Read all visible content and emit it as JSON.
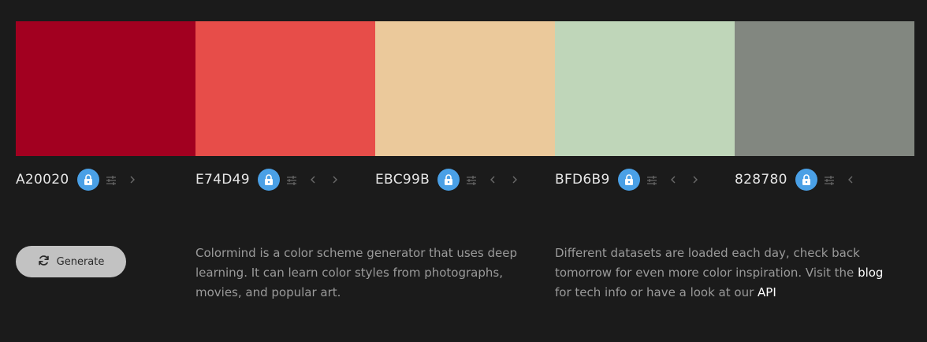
{
  "palette": {
    "colors": [
      {
        "hex": "A20020",
        "swatch": "#A20020",
        "locked": true,
        "arrows": [
          "next"
        ]
      },
      {
        "hex": "E74D49",
        "swatch": "#E74D49",
        "locked": true,
        "arrows": [
          "prev",
          "next"
        ]
      },
      {
        "hex": "EBC99B",
        "swatch": "#EBC99B",
        "locked": true,
        "arrows": [
          "prev",
          "next"
        ]
      },
      {
        "hex": "BFD6B9",
        "swatch": "#BFD6B9",
        "locked": true,
        "arrows": [
          "prev",
          "next"
        ]
      },
      {
        "hex": "828780",
        "swatch": "#828780",
        "locked": true,
        "arrows": [
          "prev"
        ]
      }
    ],
    "icons": {
      "lock": "lock-icon",
      "adjust": "sliders-icon",
      "prev": "chevron-left-icon",
      "next": "chevron-right-icon"
    }
  },
  "generate": {
    "label": "Generate",
    "icon": "refresh-icon"
  },
  "about": {
    "text": "Colormind is a color scheme generator that uses deep learning. It can learn color styles from photographs, movies, and popular art."
  },
  "info": {
    "text_before": "Different datasets are loaded each day, check back tomorrow for even more color inspiration. Visit the ",
    "blog_link": "blog",
    "text_middle": " for tech info or have a look at our ",
    "api_link": "API"
  },
  "theme": {
    "background": "#1b1b1b",
    "lock_color": "#4aa0e6",
    "button_bg": "#c2c2c2"
  }
}
